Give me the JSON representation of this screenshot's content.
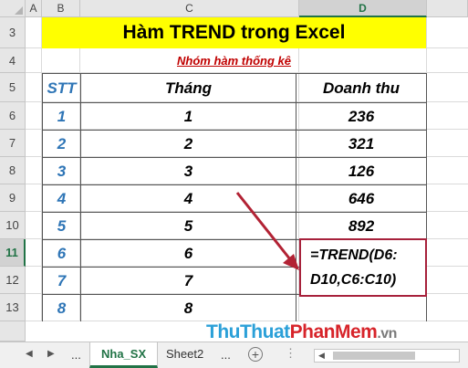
{
  "columns": [
    "A",
    "B",
    "C",
    "D"
  ],
  "rows": [
    "3",
    "4",
    "5",
    "6",
    "7",
    "8",
    "9",
    "10",
    "11",
    "12",
    "13"
  ],
  "title": "Hàm TREND trong Excel",
  "subtitle": "Nhóm hàm thống kê",
  "table": {
    "headers": [
      "STT",
      "Tháng",
      "Doanh thu"
    ],
    "rows": [
      [
        "1",
        "1",
        "236"
      ],
      [
        "2",
        "2",
        "321"
      ],
      [
        "3",
        "3",
        "126"
      ],
      [
        "4",
        "4",
        "646"
      ],
      [
        "5",
        "5",
        "892"
      ],
      [
        "6",
        "6",
        ""
      ],
      [
        "7",
        "7",
        ""
      ],
      [
        "8",
        "8",
        ""
      ]
    ]
  },
  "formula": {
    "line1": "=TREND(D6:",
    "line2": "D10,C6:C10)"
  },
  "tabs": {
    "ellipsis_left": "...",
    "active": "Nha_SX",
    "sheet2": "Sheet2",
    "ellipsis_right": "...",
    "add": "+"
  },
  "watermark": {
    "part1": "ThuThuat",
    "part2": "PhanMem",
    "part3": ".vn"
  },
  "colors": {
    "accent": "#217346",
    "title_bg": "#ffff00",
    "header_blue": "#2e75b6",
    "subtitle_red": "#c00000",
    "callout": "#a7213b"
  },
  "selected_cell": "D11"
}
